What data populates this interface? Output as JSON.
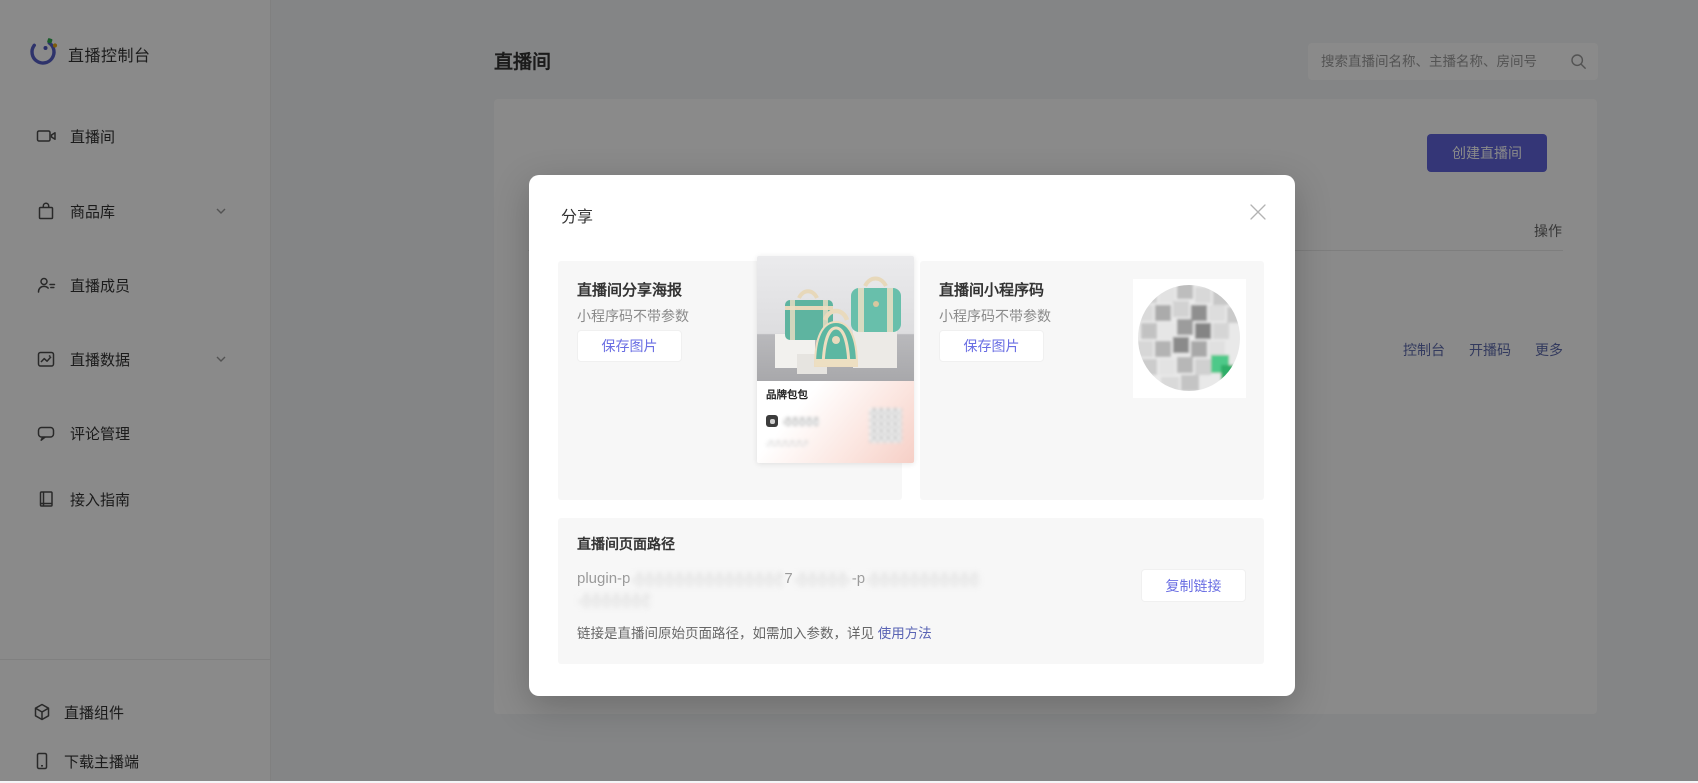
{
  "app": {
    "brand": "直播控制台"
  },
  "sidebar": {
    "items": [
      {
        "label": "直播间",
        "icon": "video-camera-icon",
        "expandable": false
      },
      {
        "label": "商品库",
        "icon": "shopping-bag-icon",
        "expandable": true
      },
      {
        "label": "直播成员",
        "icon": "member-icon",
        "expandable": false
      },
      {
        "label": "直播数据",
        "icon": "data-chart-icon",
        "expandable": true
      },
      {
        "label": "评论管理",
        "icon": "comment-icon",
        "expandable": false
      },
      {
        "label": "接入指南",
        "icon": "guide-book-icon",
        "expandable": false
      }
    ],
    "footer_items": [
      {
        "label": "直播组件",
        "icon": "cube-icon"
      },
      {
        "label": "下载主播端",
        "icon": "phone-icon"
      }
    ]
  },
  "header": {
    "page_title": "直播间",
    "search_placeholder": "搜索直播间名称、主播名称、房间号"
  },
  "content": {
    "create_button": "创建直播间",
    "table": {
      "ops_header": "操作",
      "row_actions": [
        "控制台",
        "开播码",
        "更多"
      ]
    }
  },
  "modal": {
    "title": "分享",
    "poster_card": {
      "title": "直播间分享海报",
      "subtitle": "小程序码不带参数",
      "button": "保存图片",
      "poster_badge": "品牌包包"
    },
    "qrcode_card": {
      "title": "直播间小程序码",
      "subtitle": "小程序码不带参数",
      "button": "保存图片"
    },
    "path_card": {
      "title": "直播间页面路径",
      "path_fragment_1": "plugin-p",
      "path_fragment_2": "7",
      "path_fragment_3": "-p",
      "copy_button": "复制链接",
      "note": "链接是直播间原始页面路径，如需加入参数，详见 ",
      "note_link": "使用方法"
    }
  },
  "colors": {
    "accent": "#6165dc",
    "modal_link": "#5a64b4",
    "qr_green": "#3eb575"
  }
}
